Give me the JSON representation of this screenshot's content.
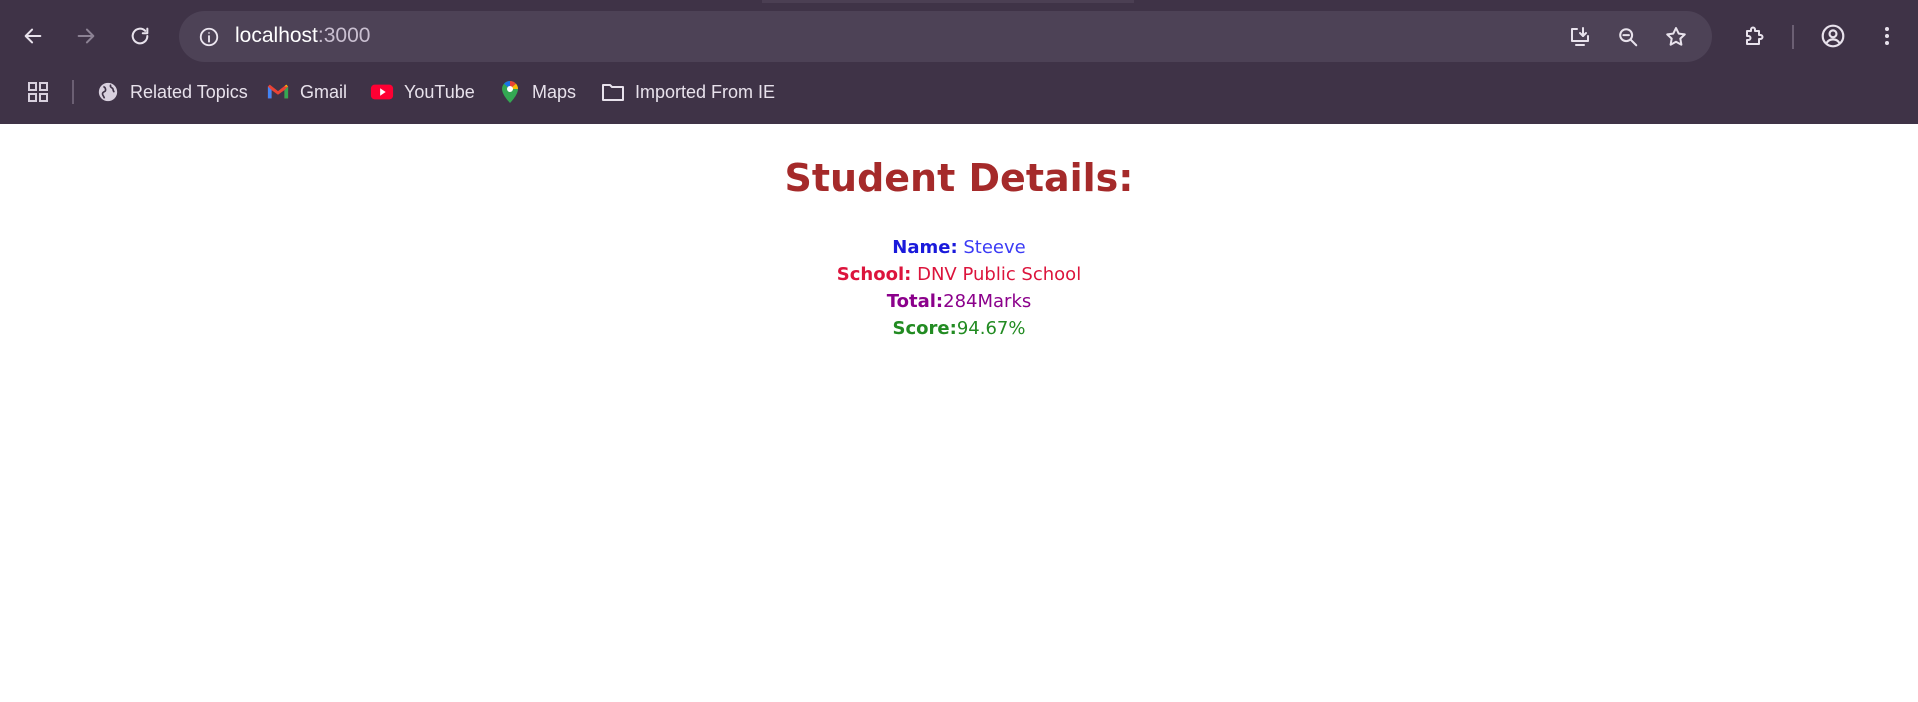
{
  "browser": {
    "url_host": "localhost",
    "url_port": ":3000",
    "icons": {
      "back": "back-arrow-icon",
      "forward": "forward-arrow-icon",
      "reload": "reload-icon",
      "site_info": "info-icon",
      "install": "install-app-icon",
      "zoom": "zoom-out-icon",
      "bookmark": "star-icon",
      "extensions": "puzzle-icon",
      "profile": "profile-icon",
      "menu": "kebab-menu-icon"
    },
    "colors": {
      "frame": "#3f3347",
      "omnibox": "#4d4256",
      "text": "#e8e2ec"
    }
  },
  "bookmarks": [
    {
      "label": "Related Topics",
      "icon": "globe-icon"
    },
    {
      "label": "Gmail",
      "icon": "gmail-icon"
    },
    {
      "label": "YouTube",
      "icon": "youtube-icon"
    },
    {
      "label": "Maps",
      "icon": "maps-pin-icon"
    },
    {
      "label": "Imported From IE",
      "icon": "folder-icon"
    }
  ],
  "page": {
    "title": "Student Details:",
    "title_color": "#a52a2a",
    "rows": [
      {
        "label": "Name:",
        "value": " Steeve",
        "color": "#1a1adb"
      },
      {
        "label": "School:",
        "value": " DNV Public School",
        "color": "#dc143c"
      },
      {
        "label": "Total:",
        "value": "284Marks",
        "color": "#8b008b"
      },
      {
        "label": "Score:",
        "value": "94.67%",
        "color": "#228b22"
      }
    ]
  }
}
